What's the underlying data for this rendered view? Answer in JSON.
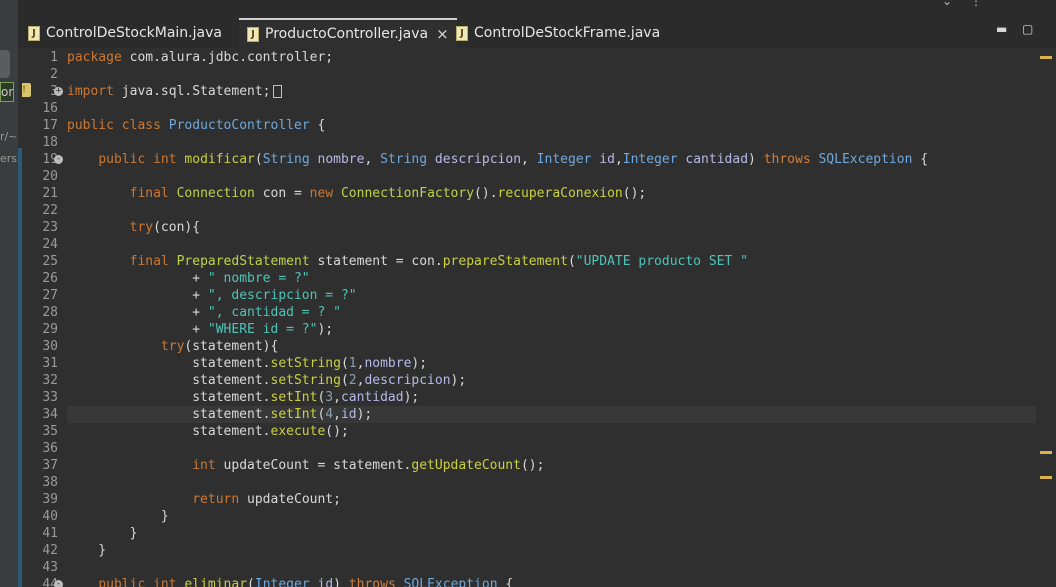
{
  "tabs": [
    {
      "label": "ControlDeStockMain.java",
      "active": false
    },
    {
      "label": "ProductoController.java",
      "active": true,
      "close": "×"
    },
    {
      "label": "ControlDeStockFrame.java",
      "active": false
    }
  ],
  "left_panel": {
    "fragment_1": "or",
    "fragment_2": "r/~/",
    "fragment_3": "ers"
  },
  "file_icon_letter": "J",
  "colors": {
    "keyword": "#cc7832",
    "string": "#4fc3b8",
    "type": "#6fa8dc",
    "method": "#c9d13e",
    "background": "#2f2f2f"
  },
  "editor": {
    "current_line": "34",
    "lines": [
      {
        "n": "1",
        "text": "package com.alura.jdbc.controller;"
      },
      {
        "n": "2",
        "text": ""
      },
      {
        "n": "3",
        "text": "import java.sql.Statement;",
        "fold": "+"
      },
      {
        "n": "16",
        "text": ""
      },
      {
        "n": "17",
        "text": "public class ProductoController {"
      },
      {
        "n": "18",
        "text": ""
      },
      {
        "n": "19",
        "text": "    public int modificar(String nombre, String descripcion, Integer id,Integer cantidad) throws SQLException {",
        "fold": "-"
      },
      {
        "n": "20",
        "text": ""
      },
      {
        "n": "21",
        "text": "        final Connection con = new ConnectionFactory().recuperaConexion();"
      },
      {
        "n": "22",
        "text": ""
      },
      {
        "n": "23",
        "text": "        try(con){"
      },
      {
        "n": "24",
        "text": ""
      },
      {
        "n": "25",
        "text": "        final PreparedStatement statement = con.prepareStatement(\"UPDATE producto SET \""
      },
      {
        "n": "26",
        "text": "                + \" nombre = ?\""
      },
      {
        "n": "27",
        "text": "                + \", descripcion = ?\""
      },
      {
        "n": "28",
        "text": "                + \", cantidad = ? \""
      },
      {
        "n": "29",
        "text": "                + \"WHERE id = ?\");"
      },
      {
        "n": "30",
        "text": "            try(statement){"
      },
      {
        "n": "31",
        "text": "                statement.setString(1,nombre);"
      },
      {
        "n": "32",
        "text": "                statement.setString(2,descripcion);"
      },
      {
        "n": "33",
        "text": "                statement.setInt(3,cantidad);"
      },
      {
        "n": "34",
        "text": "                statement.setInt(4,id);"
      },
      {
        "n": "35",
        "text": "                statement.execute();"
      },
      {
        "n": "36",
        "text": ""
      },
      {
        "n": "37",
        "text": "                int updateCount = statement.getUpdateCount();"
      },
      {
        "n": "38",
        "text": ""
      },
      {
        "n": "39",
        "text": "                return updateCount;"
      },
      {
        "n": "40",
        "text": "            }"
      },
      {
        "n": "41",
        "text": "        }"
      },
      {
        "n": "42",
        "text": "    }"
      },
      {
        "n": "43",
        "text": ""
      },
      {
        "n": "44",
        "text": "    public int eliminar(Integer id) throws SQLException {",
        "fold": "-"
      }
    ]
  }
}
